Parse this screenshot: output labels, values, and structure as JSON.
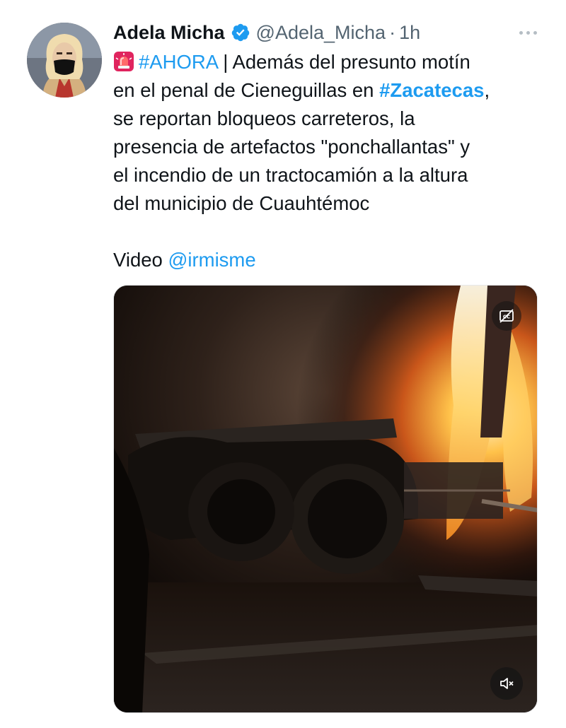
{
  "tweet": {
    "author_name": "Adela Micha",
    "handle": "@Adela_Micha",
    "separator": "·",
    "timestamp": "1h",
    "verified": true,
    "avatar_icon": "avatar",
    "body": {
      "emoji": "rotating-light-emoji",
      "hashtag_ahora": "#AHORA",
      "line1_rest": " | Además del presunto motín",
      "line2_pre": "en el penal de Cieneguillas en ",
      "hashtag_zacatecas": "#Zacatecas",
      "line2_post": ",",
      "line3": "se reportan bloqueos carreteros, la",
      "line4": "presencia de artefactos \"ponchallantas\" y",
      "line5": "el incendio de un tractocamión a la altura",
      "line6": "del municipio de Cuauhtémoc",
      "credit_label": "Video ",
      "credit_mention": "@irmisme"
    },
    "media": {
      "type": "video",
      "scene": "burning truck at night",
      "cc_icon": "captions-off-icon",
      "mute_icon": "volume-muted-icon"
    },
    "more_icon": "more-horizontal-icon"
  },
  "colors": {
    "link": "#1d9bf0",
    "text": "#0f1419",
    "secondary": "#536471",
    "verified": "#1d9bf0"
  }
}
